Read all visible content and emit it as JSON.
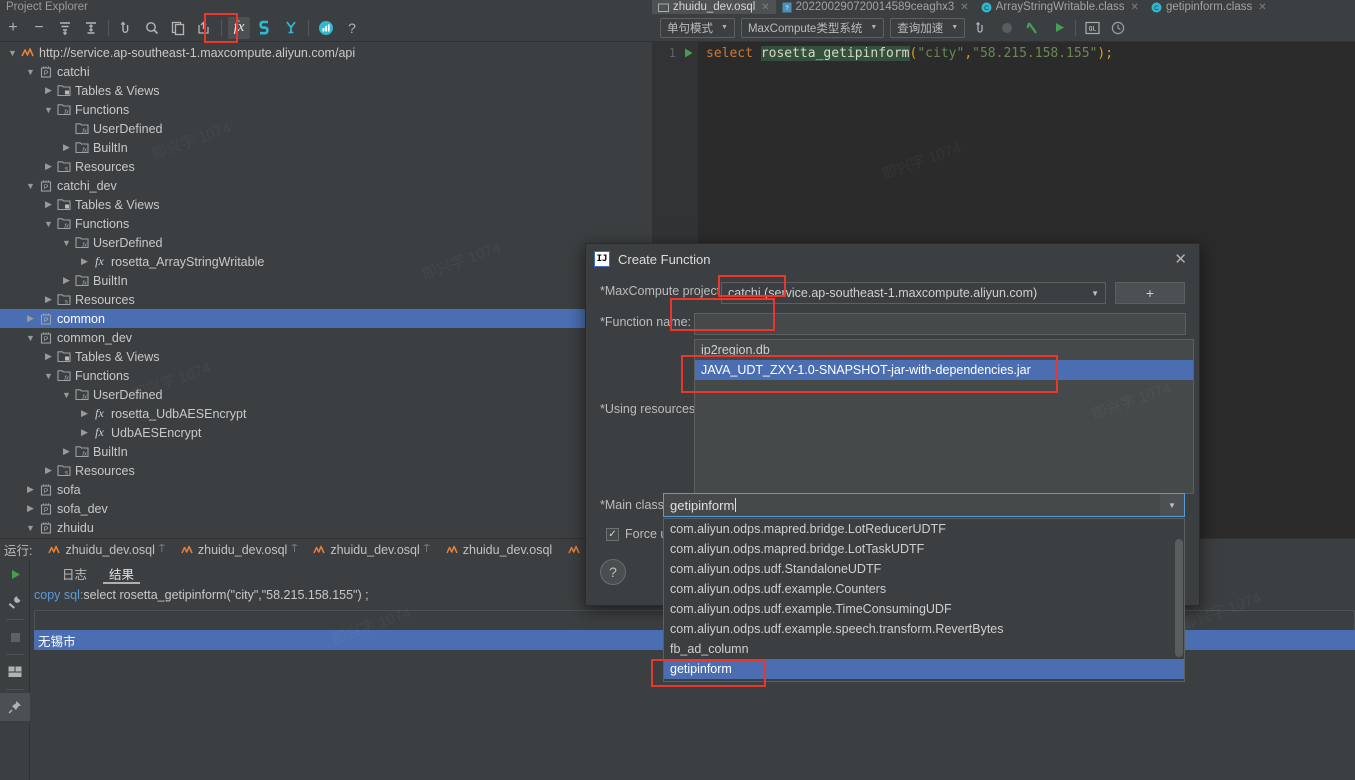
{
  "panel": {
    "title": "Project Explorer"
  },
  "explorer_toolbar": {
    "buttons": [
      {
        "name": "add",
        "glyph": "+"
      },
      {
        "name": "remove",
        "glyph": "−"
      },
      {
        "name": "expand-all",
        "glyph": "≡"
      },
      {
        "name": "collapse-all",
        "glyph": "≣"
      },
      {
        "name": "refresh",
        "glyph": "↺"
      },
      {
        "name": "search",
        "glyph": "⌕"
      },
      {
        "name": "copy",
        "glyph": "❐"
      },
      {
        "name": "upload",
        "glyph": "⇧"
      },
      {
        "name": "create-function",
        "glyph": "fx"
      },
      {
        "name": "studio",
        "glyph": "S"
      },
      {
        "name": "filter",
        "glyph": "Y"
      },
      {
        "name": "chart",
        "glyph": "■"
      },
      {
        "name": "help",
        "glyph": "?"
      }
    ]
  },
  "tree": [
    {
      "depth": 0,
      "arrow": "down",
      "icon": "odps-endpoint",
      "label": "http://service.ap-southeast-1.maxcompute.aliyun.com/api",
      "selected": false
    },
    {
      "depth": 1,
      "arrow": "down",
      "icon": "project",
      "label": "catchi",
      "selected": false
    },
    {
      "depth": 2,
      "arrow": "right",
      "icon": "tables",
      "label": "Tables & Views",
      "selected": false
    },
    {
      "depth": 2,
      "arrow": "down",
      "icon": "functions",
      "label": "Functions",
      "selected": false
    },
    {
      "depth": 3,
      "arrow": "none",
      "icon": "functions",
      "label": "UserDefined",
      "selected": false
    },
    {
      "depth": 3,
      "arrow": "right",
      "icon": "functions",
      "label": "BuiltIn",
      "selected": false
    },
    {
      "depth": 2,
      "arrow": "right",
      "icon": "resources",
      "label": "Resources",
      "selected": false
    },
    {
      "depth": 1,
      "arrow": "down",
      "icon": "project",
      "label": "catchi_dev",
      "selected": false
    },
    {
      "depth": 2,
      "arrow": "right",
      "icon": "tables",
      "label": "Tables & Views",
      "selected": false
    },
    {
      "depth": 2,
      "arrow": "down",
      "icon": "functions",
      "label": "Functions",
      "selected": false
    },
    {
      "depth": 3,
      "arrow": "down",
      "icon": "functions",
      "label": "UserDefined",
      "selected": false
    },
    {
      "depth": 4,
      "arrow": "right",
      "icon": "fx",
      "label": "rosetta_ArrayStringWritable",
      "selected": false
    },
    {
      "depth": 3,
      "arrow": "right",
      "icon": "functions",
      "label": "BuiltIn",
      "selected": false
    },
    {
      "depth": 2,
      "arrow": "right",
      "icon": "resources",
      "label": "Resources",
      "selected": false
    },
    {
      "depth": 1,
      "arrow": "right",
      "icon": "project",
      "label": "common",
      "selected": true
    },
    {
      "depth": 1,
      "arrow": "down",
      "icon": "project",
      "label": "common_dev",
      "selected": false
    },
    {
      "depth": 2,
      "arrow": "right",
      "icon": "tables",
      "label": "Tables & Views",
      "selected": false
    },
    {
      "depth": 2,
      "arrow": "down",
      "icon": "functions",
      "label": "Functions",
      "selected": false
    },
    {
      "depth": 3,
      "arrow": "down",
      "icon": "functions",
      "label": "UserDefined",
      "selected": false
    },
    {
      "depth": 4,
      "arrow": "right",
      "icon": "fx",
      "label": "rosetta_UdbAESEncrypt",
      "selected": false
    },
    {
      "depth": 4,
      "arrow": "right",
      "icon": "fx",
      "label": "UdbAESEncrypt",
      "selected": false
    },
    {
      "depth": 3,
      "arrow": "right",
      "icon": "functions",
      "label": "BuiltIn",
      "selected": false
    },
    {
      "depth": 2,
      "arrow": "right",
      "icon": "resources",
      "label": "Resources",
      "selected": false
    },
    {
      "depth": 1,
      "arrow": "right",
      "icon": "project",
      "label": "sofa",
      "selected": false
    },
    {
      "depth": 1,
      "arrow": "right",
      "icon": "project",
      "label": "sofa_dev",
      "selected": false
    },
    {
      "depth": 1,
      "arrow": "down",
      "icon": "project",
      "label": "zhuidu",
      "selected": false
    }
  ],
  "editor_tabs": [
    {
      "label": "zhuidu_dev.osql",
      "icon": "osql-icon",
      "active": true
    },
    {
      "label": "202200290720014589ceaghx3",
      "icon": "file-icon",
      "active": false
    },
    {
      "label": "ArrayStringWritable.class",
      "icon": "class-icon",
      "active": false
    },
    {
      "label": "getipinform.class",
      "icon": "class-icon",
      "active": false
    }
  ],
  "editor_toolbar": {
    "mode_select": "单句模式",
    "type_system_select": "MaxCompute类型系统",
    "accel_select": "查询加速",
    "icons": [
      "sync-icon",
      "stop-icon",
      "compile-icon",
      "run-icon",
      "ql-icon",
      "history-icon"
    ]
  },
  "code": {
    "line_number": "1",
    "tokens": [
      {
        "t": "select",
        "c": "k-select"
      },
      {
        "t": " ",
        "c": ""
      },
      {
        "t": "rosetta_getipinform",
        "c": "k-fn"
      },
      {
        "t": "(",
        "c": "k-paren"
      },
      {
        "t": "\"city\"",
        "c": "k-str"
      },
      {
        "t": ",",
        "c": "k-comma"
      },
      {
        "t": "\"58.215.158.155\"",
        "c": "k-str"
      },
      {
        "t": ");",
        "c": "k-paren"
      }
    ]
  },
  "run_panel": {
    "label": "运行:",
    "tabs": [
      {
        "label": "zhuidu_dev.osql",
        "pinned": true,
        "active": false
      },
      {
        "label": "zhuidu_dev.osql",
        "pinned": true,
        "active": false
      },
      {
        "label": "zhuidu_dev.osql",
        "pinned": true,
        "active": false
      },
      {
        "label": "zhuidu_dev.osql",
        "pinned": false,
        "active": false
      },
      {
        "label": "zhuidu_dev.osql",
        "pinned": true,
        "active": false
      },
      {
        "label": "zhuidu_dev.osql",
        "pinned": false,
        "active": true
      }
    ],
    "sub_tabs": [
      {
        "label": "日志",
        "active": false
      },
      {
        "label": "结果",
        "active": true
      }
    ],
    "copy_sql_link": "copy sql:",
    "copy_sql_text": "select rosetta_getipinform(\"city\",\"58.215.158.155\") ;",
    "result_row": "无锡市",
    "side_buttons": [
      "run-icon",
      "wrench-icon",
      "stop-icon",
      "layout-icon",
      "pin-icon"
    ]
  },
  "dialog": {
    "title": "Create Function",
    "logo": "IJ",
    "close": "✕",
    "project_label": "*MaxCompute project:",
    "project_value": "catchi (service.ap-southeast-1.maxcompute.aliyun.com)",
    "add_button": "+",
    "function_name_label": "*Function name:",
    "function_name_value": "",
    "using_resources_label": "*Using resources:",
    "resources": [
      {
        "label": "ip2region.db",
        "selected": false
      },
      {
        "label": "JAVA_UDT_ZXY-1.0-SNAPSHOT-jar-with-dependencies.jar",
        "selected": true
      }
    ],
    "main_class_label": "*Main class:",
    "main_class_value": "getipinform",
    "main_class_options": [
      {
        "label": "com.aliyun.odps.mapred.bridge.LotReducerUDTF",
        "selected": false
      },
      {
        "label": "com.aliyun.odps.mapred.bridge.LotTaskUDTF",
        "selected": false
      },
      {
        "label": "com.aliyun.odps.udf.StandaloneUDTF",
        "selected": false
      },
      {
        "label": "com.aliyun.odps.udf.example.Counters",
        "selected": false
      },
      {
        "label": "com.aliyun.odps.udf.example.TimeConsumingUDF",
        "selected": false
      },
      {
        "label": "com.aliyun.odps.udf.example.speech.transform.RevertBytes",
        "selected": false
      },
      {
        "label": "fb_ad_column",
        "selected": false
      },
      {
        "label": "getipinform",
        "selected": true
      }
    ],
    "force_label": "Force u",
    "force_checked": true,
    "help": "?"
  },
  "colors": {
    "bg": "#3c3f41",
    "editor_bg": "#2b2b2b",
    "selection_blue": "#4b6eb3",
    "annotation_red": "#e8372c",
    "accent_cyan": "#2fb8d0",
    "link_blue": "#5b9bd5",
    "run_green": "#499c54"
  },
  "watermarks": [
    "即兴字 1074",
    "即兴字 1074",
    "即兴字 1074",
    "即兴字 1074",
    "即兴字 1074",
    "即兴字 1074",
    "即兴字 1074",
    "即兴字 1074"
  ]
}
